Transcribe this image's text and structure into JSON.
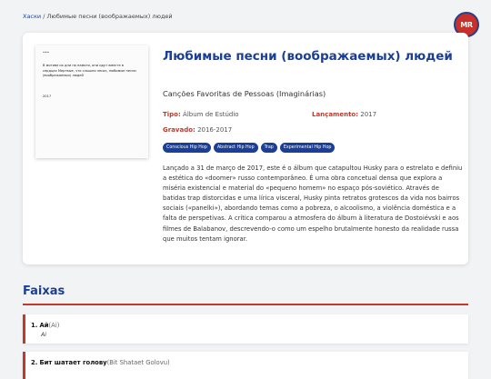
{
  "breadcrumb": {
    "link": "Хаски",
    "separator": " / ",
    "current": "Любимые песни (воображаемых) людей"
  },
  "logo": {
    "text": "MR"
  },
  "album": {
    "title": "Любимые песни (воображаемых) людей",
    "subtitle": "Canções Favoritas de Pessoas (Imaginárias)",
    "type_label": "Tipo:",
    "type_value": "Álbum de Estúdio",
    "release_label": "Lançamento:",
    "release_value": "2017",
    "recorded_label": "Gravado:",
    "recorded_value": "2016-2017",
    "tags": [
      "Conscious Hip Hop",
      "Abstract Hip Hop",
      "Trap",
      "Experimental Hip Hop"
    ],
    "description": "Lançado a 31 de março de 2017, este é o álbum que catapultou Husky para o estrelato e definiu a estética do «doomer» russo contemporâneo. É uma obra concetual densa que explora a miséria existencial e material do «pequeno homem» no espaço pós-soviético. Através de batidas trap distorcidas e uma lírica visceral, Husky pinta retratos grotescos da vida nos bairros sociais («panelki»), abordando temas como a pobreza, o alcoolismo, a violência doméstica e a falta de perspetivas. A crítica comparou a atmosfera do álbum à literatura de Dostoiévski e aos filmes de Balabanov, descrevendo-o como um espelho brutalmente honesto da realidade russa que muitos tentam ignorar."
  },
  "cover": {
    "dots": "•••",
    "lines": "В мотиве их дни на памяти, они идут вместе в сердцах Мертвые, что слышно лесах, любимые песни (воображаемых) людей",
    "year": "2017"
  },
  "tracks_section": {
    "title": "Faixas"
  },
  "tracks": [
    {
      "number": "1.",
      "title": "Ай",
      "alt": "(Ai)",
      "subtitle": "Ai"
    },
    {
      "number": "2.",
      "title": "Бит шатает голову",
      "alt": "(Bit Shataet Golovu)",
      "subtitle": ""
    }
  ]
}
